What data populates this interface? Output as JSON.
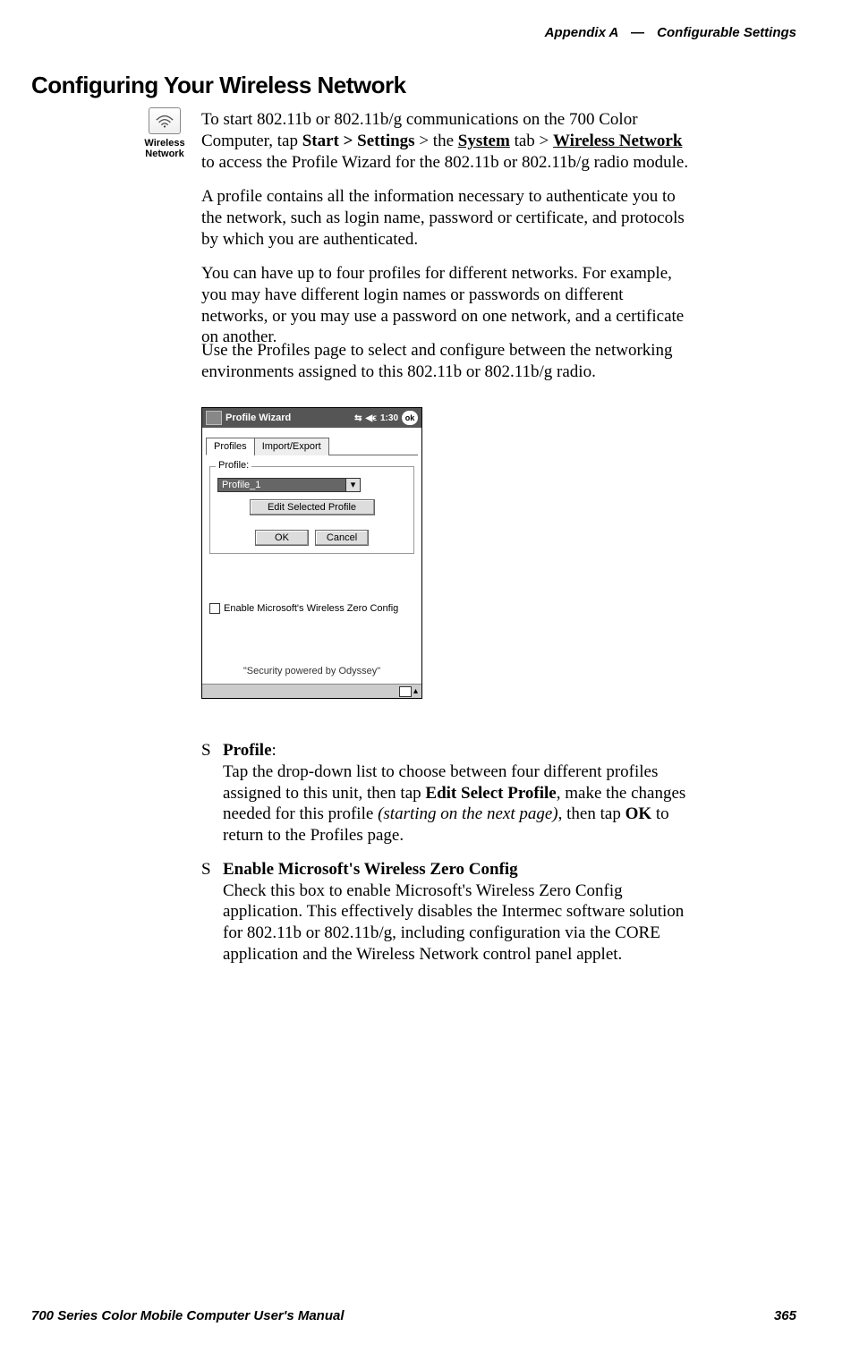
{
  "header": {
    "appendix": "Appendix A",
    "dash": "—",
    "section": "Configurable Settings"
  },
  "heading": "Configuring Your Wireless Network",
  "icon": {
    "label_line1": "Wireless",
    "label_line2": "Network"
  },
  "paragraphs": {
    "p1_pre": "To start 802.11b or 802.11b/g communications on the 700 Color Computer, tap ",
    "p1_b1": "Start > Settings",
    "p1_m1": " > the ",
    "p1_u1": "System",
    "p1_m2": " tab > ",
    "p1_u2": "Wireless Network",
    "p1_post": " to access the Profile Wizard for the 802.11b or 802.11b/g radio module.",
    "p2": "A profile contains all the information necessary to authenticate you to the network, such as login name, password or certificate, and protocols by which you are authenticated.",
    "p3": "You can have up to four profiles for different networks. For example, you may have different login names or passwords on different networks, or you may use a password on one network, and a certificate on another.",
    "p4": "Use the Profiles page to select and configure between the networking environments assigned to this 802.11b or 802.11b/g radio."
  },
  "pda": {
    "title": "Profile Wizard",
    "time": "1:30",
    "ok": "ok",
    "tabs": {
      "t1": "Profiles",
      "t2": "Import/Export"
    },
    "group_label": "Profile:",
    "dropdown_value": "Profile_1",
    "dropdown_arrow": "▾",
    "edit_btn": "Edit Selected Profile",
    "ok_btn": "OK",
    "cancel_btn": "Cancel",
    "checkbox_label": "Enable Microsoft's Wireless Zero Config",
    "footer": "\"Security powered by Odyssey\"",
    "arrow_up": "▴"
  },
  "bullets": {
    "b1_title": "Profile",
    "b1_colon": ":",
    "b1_body_pre": "Tap the drop-down list to choose between four different profiles assigned to this unit, then tap ",
    "b1_bold1": "Edit Select Profile",
    "b1_body_mid": ", make the changes needed for this profile ",
    "b1_italic": "(starting on the next page)",
    "b1_body_mid2": ", then tap ",
    "b1_bold2": "OK",
    "b1_body_post": " to return to the Profiles page.",
    "b2_title": "Enable Microsoft's Wireless Zero Config",
    "b2_body": "Check this box to enable Microsoft's Wireless Zero Config application. This effectively disables the Intermec software solution for 802.11b or 802.11b/g, including configuration via the CORE application and the Wireless Network control panel applet."
  },
  "footer": {
    "manual": "700 Series Color Mobile Computer User's Manual",
    "page": "365"
  }
}
